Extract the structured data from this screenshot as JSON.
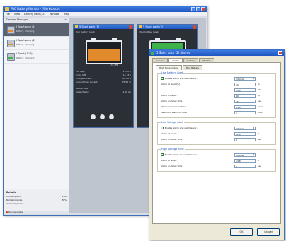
{
  "app": {
    "title": "PBC Battery Monitor - [Workspace]",
    "menu": [
      "File",
      "View",
      "Battery Pack (Ct)",
      "Window",
      "Help"
    ]
  },
  "left_panel": {
    "header": "Devices Manager",
    "devices": [
      {
        "name": "5 Sport pack (1)",
        "sub": "Battery: Charging"
      },
      {
        "name": "5 Sport pack (2)",
        "sub": "Battery: Charging"
      },
      {
        "name": "5 Sport (1 ID)",
        "sub": "Battery: Charging"
      }
    ],
    "details": {
      "header": "Details",
      "rows": [
        {
          "k": "Consumption:",
          "v": "1.00"
        },
        {
          "k": "Remaining cap.:",
          "v": "80%"
        },
        {
          "k": "Available power:",
          "v": "—"
        }
      ]
    },
    "status": "Device status"
  },
  "cards": [
    {
      "title": "5 Sport pack (1)",
      "head": "Your battery level:",
      "percent": "75.0%",
      "fill_fraction": 0.75,
      "rows": [
        {
          "k": "Full cap.:",
          "v": "15.00 h"
        },
        {
          "k": "Cycle left:",
          "v": "13.33 h"
        },
        {
          "k": "Charge current:",
          "v": "68.00 A"
        },
        {
          "k": "Current/max current:",
          "v": "75.00 %"
        },
        {
          "k": "SEP",
          "v": ""
        },
        {
          "k": "Status: Idle",
          "v": ""
        },
        {
          "k": "Slow charge:",
          "v": "1.00 Ah"
        }
      ]
    },
    {
      "title": "5 Sport pack (2)",
      "head": "Your battery level:",
      "percent": "100.0%",
      "fill_fraction": 1.0,
      "rows": []
    }
  ],
  "dialog": {
    "title": "5 Sport pack (2) Alarms",
    "tabs": [
      "General",
      "Alarms",
      "Battery",
      "Monitor"
    ],
    "active_tab": "Alarms",
    "subtabs": [
      "High Temperature",
      "Min. Battery"
    ],
    "groups": [
      {
        "title": "Low Battery Alert",
        "rows": [
          {
            "type": "check",
            "label": "Enable alarm and set interval :",
            "value": "Interval",
            "select": true
          },
          {
            "type": "text",
            "label": "Alarm at level (%) :",
            "value": "10",
            "unit": "%"
          },
          {
            "type": "text",
            "label": "",
            "value": "15.0",
            "unit": "Ah"
          },
          {
            "type": "text",
            "label": "Alarm on level :",
            "value": "40",
            "unit": "%"
          },
          {
            "type": "text",
            "label": "Alarm on delay time :",
            "value": "15",
            "unit": "sec"
          },
          {
            "type": "text",
            "label": "Minimum alarm on time :",
            "value": "0.00",
            "unit": "hour"
          },
          {
            "type": "text",
            "label": "Maximum alarm on time :",
            "value": "1",
            "unit": "hour"
          }
        ]
      },
      {
        "title": "Low Voltage Alert",
        "rows": [
          {
            "type": "check",
            "label": "Enable alarm and set interval :",
            "value": "Interval",
            "select": true
          },
          {
            "type": "text",
            "label": "Alarm at level :",
            "value": "11.0",
            "unit": "V"
          },
          {
            "type": "text",
            "label": "Alarm on delay time :",
            "value": "3",
            "unit": "sec"
          }
        ]
      },
      {
        "title": "High Voltage Alert",
        "rows": [
          {
            "type": "check",
            "label": "Enable alarm and set interval :",
            "value": "Interval",
            "select": true
          },
          {
            "type": "text",
            "label": "Alarm at level :",
            "value": "14.8",
            "unit": "V"
          },
          {
            "type": "text",
            "label": "Alarm on delay time :",
            "value": "3",
            "unit": "sec"
          }
        ]
      }
    ],
    "ok_label": "OK",
    "cancel_label": "Cancel"
  },
  "colors": {
    "accent": "#1f56c2",
    "battery_orange": "#e08a2c",
    "battery_green": "#3db34a"
  }
}
